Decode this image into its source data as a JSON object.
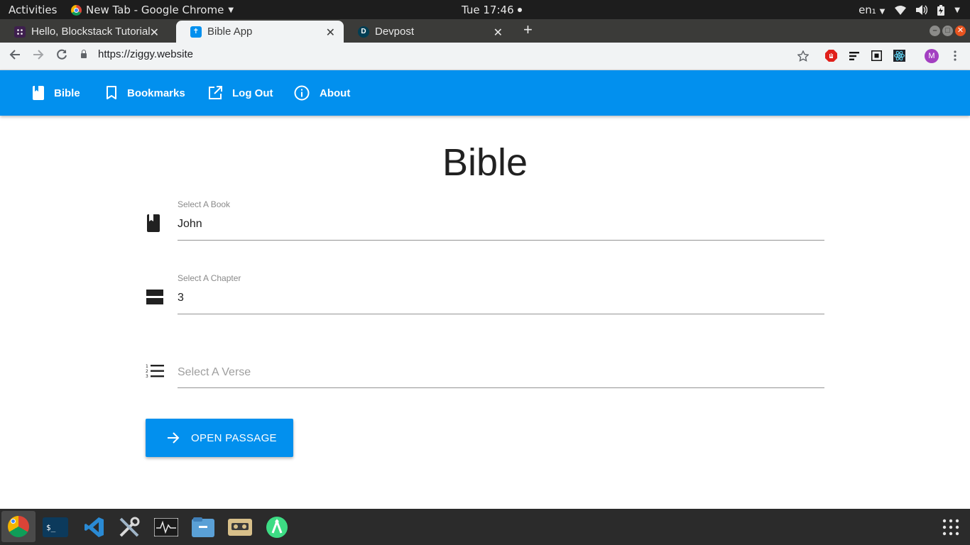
{
  "system_bar": {
    "activities": "Activities",
    "app_menu_label": "New Tab - Google Chrome",
    "clock": "Tue 17:46",
    "keyboard_layout": "en₁"
  },
  "tabs": [
    {
      "title": "Hello, Blockstack Tutorial",
      "favicon": "blockstack-icon",
      "favicon_color": "#3e1f4e",
      "active": false
    },
    {
      "title": "Bible App",
      "favicon": "cross-icon",
      "favicon_color": "#0290ee",
      "active": true
    },
    {
      "title": "Devpost",
      "favicon": "devpost-icon",
      "favicon_color": "#003e54",
      "active": false
    }
  ],
  "address_bar": {
    "url": "https://ziggy.website"
  },
  "profile": {
    "initial": "M",
    "color": "#a33fc1"
  },
  "navbar": {
    "items": [
      {
        "label": "Bible",
        "icon": "book-icon"
      },
      {
        "label": "Bookmarks",
        "icon": "bookmark-icon"
      },
      {
        "label": "Log Out",
        "icon": "open-external-icon"
      },
      {
        "label": "About",
        "icon": "info-icon"
      }
    ],
    "color": "#0290ee"
  },
  "page": {
    "title": "Bible",
    "book_field": {
      "label": "Select A Book",
      "value": "John"
    },
    "chapter_field": {
      "label": "Select A Chapter",
      "value": "3"
    },
    "verse_field": {
      "placeholder": "Select A Verse",
      "value": ""
    },
    "open_button": "OPEN PASSAGE"
  },
  "dock": {
    "apps": [
      "chrome-icon",
      "terminal-icon",
      "vscode-icon",
      "tools-icon",
      "system-monitor-icon",
      "files-icon",
      "recorder-icon",
      "android-studio-icon",
      "app-grid-icon"
    ]
  }
}
